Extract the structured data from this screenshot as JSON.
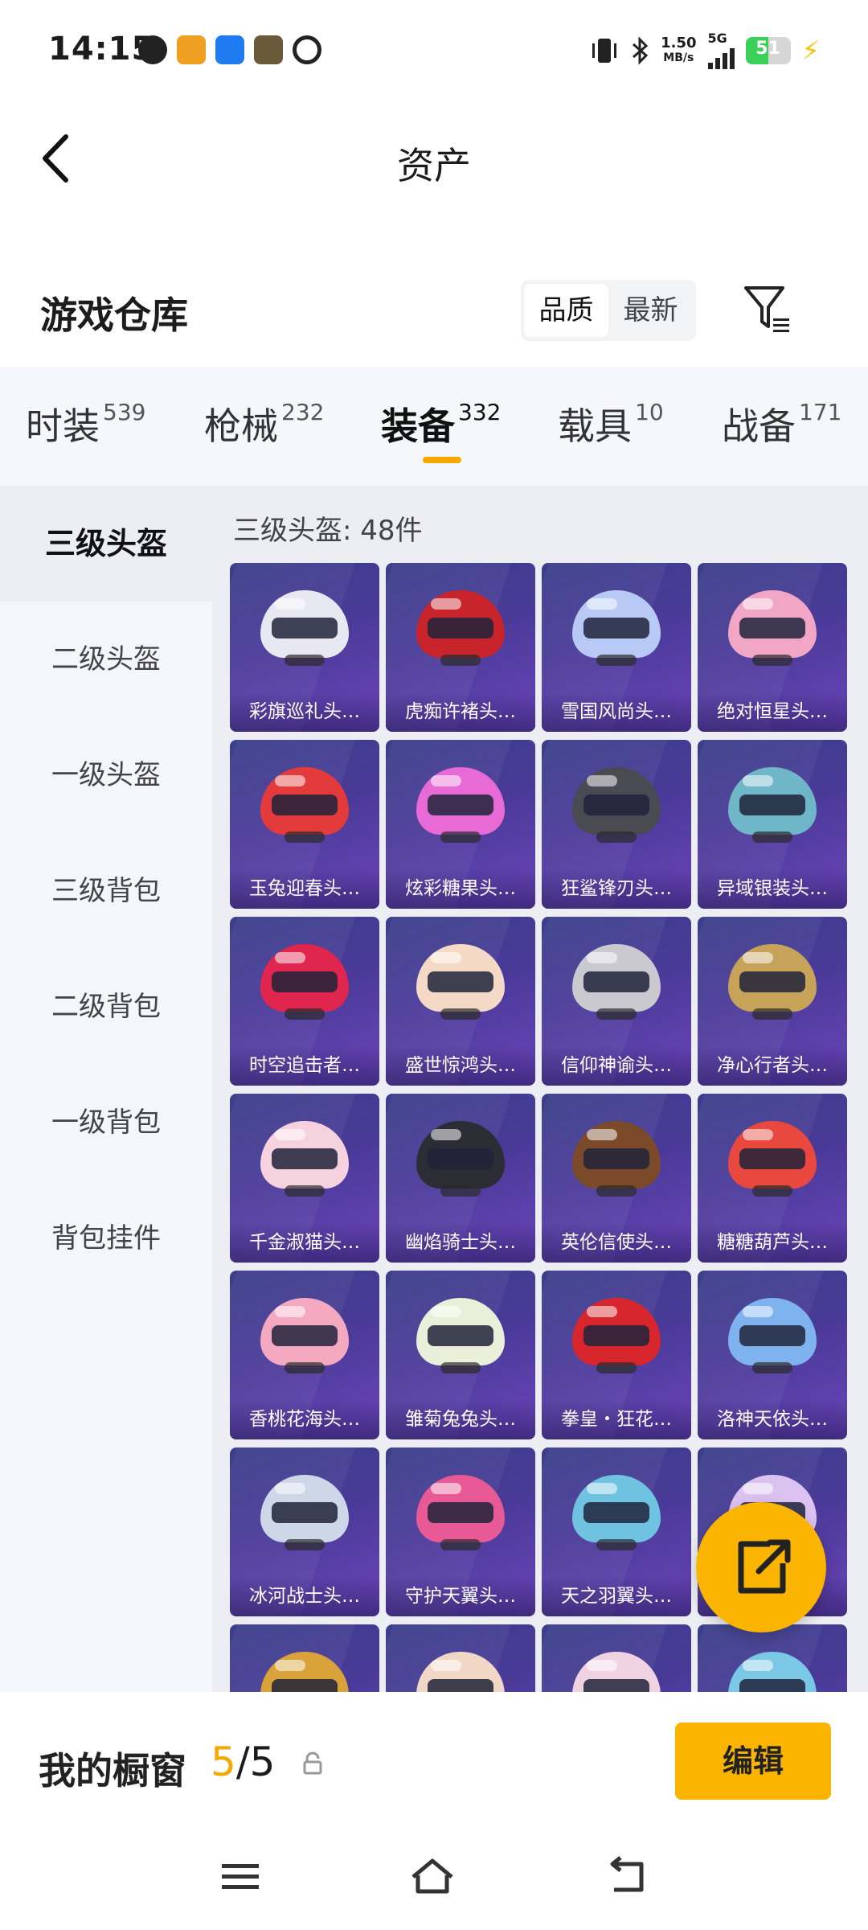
{
  "status": {
    "time": "14:15",
    "speed_top": "1.50",
    "speed_bottom": "MB/s",
    "network": "5G",
    "battery": "51",
    "battery_fraction": 0.51
  },
  "header": {
    "title": "资产"
  },
  "warehouse": {
    "title": "游戏仓库",
    "sort_options": [
      "品质",
      "最新"
    ]
  },
  "tabs": [
    {
      "label": "时装",
      "count": "539"
    },
    {
      "label": "枪械",
      "count": "232"
    },
    {
      "label": "装备",
      "count": "332"
    },
    {
      "label": "载具",
      "count": "10"
    },
    {
      "label": "战备",
      "count": "171"
    }
  ],
  "sidebar": [
    {
      "label": "三级头盔"
    },
    {
      "label": "二级头盔"
    },
    {
      "label": "一级头盔"
    },
    {
      "label": "三级背包"
    },
    {
      "label": "二级背包"
    },
    {
      "label": "一级背包"
    },
    {
      "label": "背包挂件"
    }
  ],
  "content": {
    "count_text": "三级头盔: 48件",
    "items": [
      {
        "name": "彩旗巡礼头…",
        "color": "#e8e8f2"
      },
      {
        "name": "虎痴许褚头…",
        "color": "#c8242c"
      },
      {
        "name": "雪国风尚头…",
        "color": "#b9c9f5"
      },
      {
        "name": "绝对恒星头…",
        "color": "#f2a6c6"
      },
      {
        "name": "玉兔迎春头…",
        "color": "#e33b3b"
      },
      {
        "name": "炫彩糖果头…",
        "color": "#e86ad6"
      },
      {
        "name": "狂鲨锋刃头…",
        "color": "#4a4a52"
      },
      {
        "name": "异域银装头…",
        "color": "#6fb6c9"
      },
      {
        "name": "时空追击者…",
        "color": "#e0254e"
      },
      {
        "name": "盛世惊鸿头…",
        "color": "#f4d9c6"
      },
      {
        "name": "信仰神谕头…",
        "color": "#c9c9cf"
      },
      {
        "name": "净心行者头…",
        "color": "#c7a35a"
      },
      {
        "name": "千金淑猫头…",
        "color": "#f6d2df"
      },
      {
        "name": "幽焰骑士头…",
        "color": "#2c2c34"
      },
      {
        "name": "英伦信使头…",
        "color": "#7a4a2a"
      },
      {
        "name": "糖糖葫芦头…",
        "color": "#e8483e"
      },
      {
        "name": "香桃花海头…",
        "color": "#f5a9c0"
      },
      {
        "name": "雏菊兔兔头…",
        "color": "#e9efd8"
      },
      {
        "name": "拳皇・狂花…",
        "color": "#d8262e"
      },
      {
        "name": "洛神天依头…",
        "color": "#7fb3f0"
      },
      {
        "name": "冰河战士头…",
        "color": "#cdd7e8"
      },
      {
        "name": "守护天翼头…",
        "color": "#e85a96"
      },
      {
        "name": "天之羽翼头…",
        "color": "#6fc2e0"
      },
      {
        "name": "",
        "color": "#dcc2f0"
      },
      {
        "name": "",
        "color": "#d9a23a"
      },
      {
        "name": "",
        "color": "#f1d7c6"
      },
      {
        "name": "",
        "color": "#f0d3e2"
      },
      {
        "name": "",
        "color": "#7ac7e6"
      }
    ]
  },
  "bottom": {
    "label": "我的橱窗",
    "used": "5",
    "sep_total": "/5",
    "edit_label": "编辑"
  },
  "accent": "#fbb500"
}
